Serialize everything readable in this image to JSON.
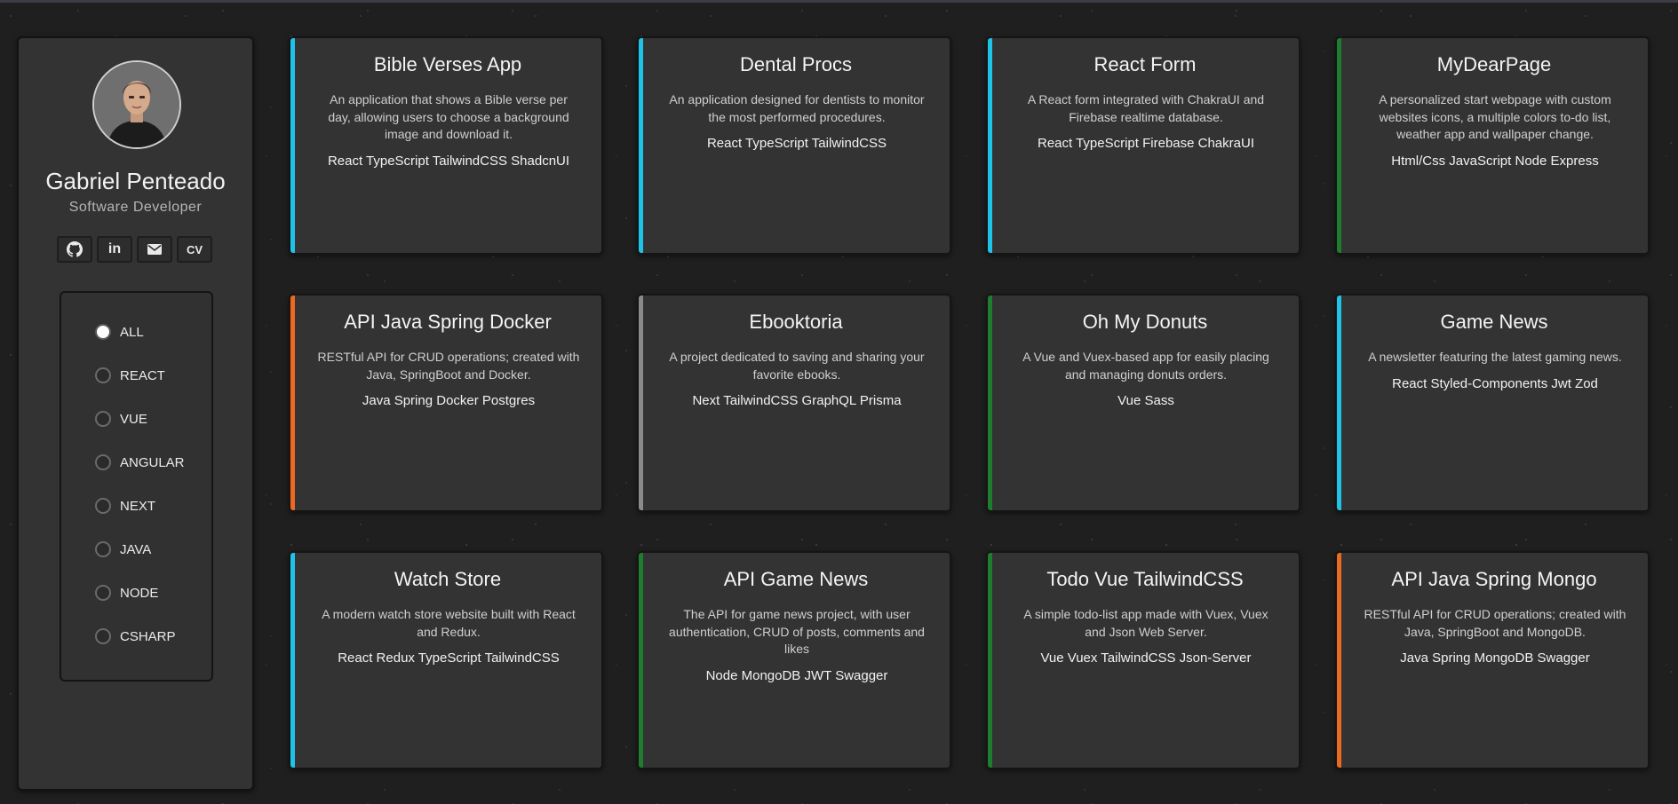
{
  "colors": {
    "background": "#1f1f1f",
    "panel": "#333333",
    "react": "#1fc3e8",
    "vue": "#1e7d2e",
    "java": "#ec6a1f",
    "next": "#8a8a8a"
  },
  "profile": {
    "name": "Gabriel Penteado",
    "role": "Software Developer",
    "social": {
      "github_icon": "github-icon",
      "linkedin_label": "in",
      "mail_icon": "mail-icon",
      "cv_label": "CV"
    }
  },
  "filters": {
    "selected": "ALL",
    "options": [
      "ALL",
      "REACT",
      "VUE",
      "ANGULAR",
      "NEXT",
      "JAVA",
      "NODE",
      "CSHARP"
    ]
  },
  "projects": [
    {
      "title": "Bible Verses App",
      "description": "An application that shows a Bible verse per day, allowing users to choose a background image and download it.",
      "tech": "React TypeScript TailwindCSS ShadcnUI",
      "accent": "react"
    },
    {
      "title": "Dental Procs",
      "description": "An application designed for dentists to monitor the most performed procedures.",
      "tech": "React TypeScript TailwindCSS",
      "accent": "react"
    },
    {
      "title": "React Form",
      "description": "A React form integrated with ChakraUI and Firebase realtime database.",
      "tech": "React TypeScript Firebase ChakraUI",
      "accent": "react"
    },
    {
      "title": "MyDearPage",
      "description": "A personalized start webpage with custom websites icons, a multiple colors to-do list, weather app and wallpaper change.",
      "tech": "Html/Css JavaScript Node Express",
      "accent": "vue"
    },
    {
      "title": "API Java Spring Docker",
      "description": "RESTful API for CRUD operations; created with Java, SpringBoot and Docker.",
      "tech": "Java Spring Docker Postgres",
      "accent": "java"
    },
    {
      "title": "Ebooktoria",
      "description": "A project dedicated to saving and sharing your favorite ebooks.",
      "tech": "Next TailwindCSS GraphQL Prisma",
      "accent": "next"
    },
    {
      "title": "Oh My Donuts",
      "description": "A Vue and Vuex-based app for easily placing and managing donuts orders.",
      "tech": "Vue Sass",
      "accent": "vue"
    },
    {
      "title": "Game News",
      "description": "A newsletter featuring the latest gaming news.",
      "tech": "React Styled-Components Jwt Zod",
      "accent": "react"
    },
    {
      "title": "Watch Store",
      "description": "A modern watch store website built with React and Redux.",
      "tech": "React Redux TypeScript TailwindCSS",
      "accent": "react"
    },
    {
      "title": "API Game News",
      "description": "The API for game news project, with user authentication, CRUD of posts, comments and likes",
      "tech": "Node MongoDB JWT Swagger",
      "accent": "vue"
    },
    {
      "title": "Todo Vue TailwindCSS",
      "description": "A simple todo-list app made with Vuex, Vuex and Json Web Server.",
      "tech": "Vue Vuex TailwindCSS Json-Server",
      "accent": "vue"
    },
    {
      "title": "API Java Spring Mongo",
      "description": "RESTful API for CRUD operations; created with Java, SpringBoot and MongoDB.",
      "tech": "Java Spring MongoDB Swagger",
      "accent": "java"
    }
  ]
}
